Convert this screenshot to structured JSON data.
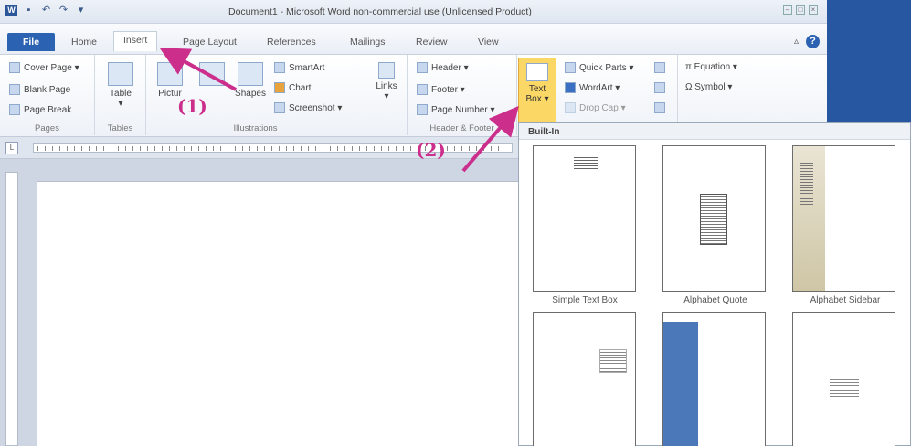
{
  "window": {
    "title": "Document1 - Microsoft Word non-commercial use (Unlicensed Product)"
  },
  "tabs": [
    {
      "label": "File"
    },
    {
      "label": "Home"
    },
    {
      "label": "Insert"
    },
    {
      "label": "Page Layout"
    },
    {
      "label": "References"
    },
    {
      "label": "Mailings"
    },
    {
      "label": "Review"
    },
    {
      "label": "View"
    }
  ],
  "ribbon": {
    "pages": {
      "items": [
        "Cover Page ▾",
        "Blank Page",
        "Page Break"
      ],
      "label": "Pages"
    },
    "tables": {
      "table": "Table",
      "label": "Tables"
    },
    "illustrations": {
      "picture": "Pictur",
      "shapes": "Shapes",
      "smartart": "SmartArt",
      "chart": "Chart",
      "screenshot": "Screenshot ▾",
      "label": "Illustrations"
    },
    "links": {
      "links": "Links"
    },
    "header_footer": {
      "header": "Header ▾",
      "footer": "Footer ▾",
      "page_number": "Page Number ▾",
      "label": "Header & Footer"
    },
    "text": {
      "textbox_line1": "Text",
      "textbox_line2": "Box ▾",
      "quick_parts": "Quick Parts ▾",
      "wordart": "WordArt ▾",
      "drop_cap": "Drop Cap ▾"
    },
    "symbols": {
      "equation": "π Equation ▾",
      "symbol": "Ω Symbol ▾"
    }
  },
  "gallery": {
    "header": "Built-In",
    "items": [
      {
        "caption": "Simple Text Box"
      },
      {
        "caption": "Alphabet Quote"
      },
      {
        "caption": "Alphabet Sidebar"
      }
    ]
  },
  "annotations": {
    "step1": "(1)",
    "step2": "(2)",
    "color": "#cc2e8c"
  },
  "colors": {
    "file_tab": "#2b63b2",
    "textbox_highlight": "#fbd866",
    "sidebar_blue": "#4a78b8",
    "dark_panel": "#2857a1"
  }
}
